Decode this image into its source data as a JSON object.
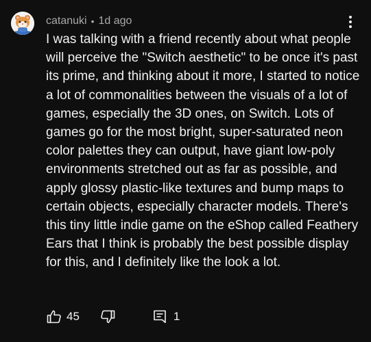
{
  "comment": {
    "avatar_icon": "hamster-avatar-icon",
    "username": "catanuki",
    "separator": "•",
    "time": "1d ago",
    "menu_icon": "more-vert-icon",
    "text": "I was talking with a friend recently about what people will perceive the \"Switch aesthetic\" to be once it's past its prime, and thinking about it more, I started to notice a lot of commonalities between the visuals of a lot of games, especially the 3D ones, on Switch. Lots of games go for the most bright, super-saturated neon color palettes they can output, have giant low-poly environments stretched out as far as possible, and apply glossy plastic-like textures and bump maps to certain objects, especially character models. There's this tiny little indie game on the eShop called Feathery Ears that I think is probably the best possible display for this, and I definitely like the look a lot.",
    "actions": {
      "like_icon": "thumbs-up-icon",
      "like_count": "45",
      "dislike_icon": "thumbs-down-icon",
      "reply_icon": "replies-icon",
      "reply_count": "1"
    }
  },
  "colors": {
    "background": "#0f0f0f",
    "text": "#f1f1f1",
    "meta": "#aaaaaa"
  }
}
